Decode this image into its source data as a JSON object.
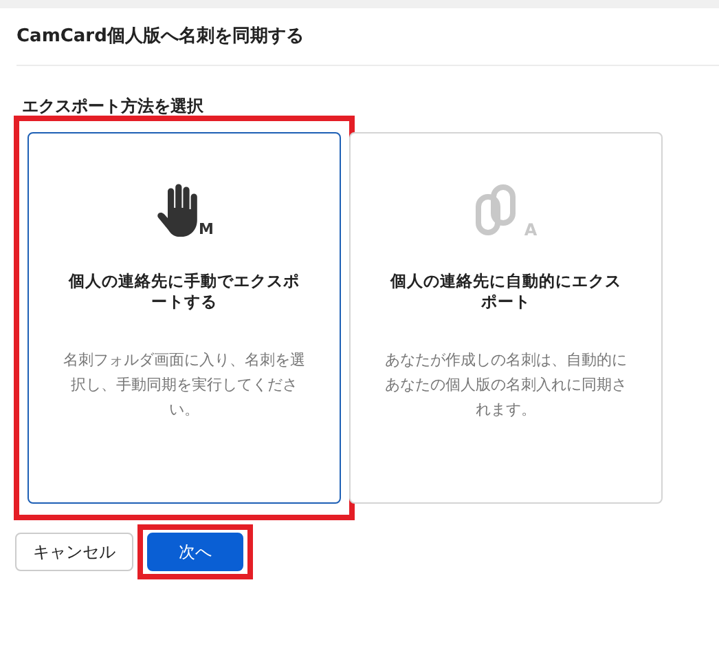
{
  "dialog": {
    "title": "CamCard個人版へ名刺を同期する"
  },
  "section": {
    "heading": "エクスポート方法を選択"
  },
  "options": [
    {
      "kind": "manual",
      "badge": "M",
      "title": "個人の連絡先に手動でエクスポートする",
      "description": "名刺フォルダ画面に入り、名刺を選択し、手動同期を実行してください。",
      "selected": true,
      "highlighted": true
    },
    {
      "kind": "auto",
      "badge": "A",
      "title": "個人の連絡先に自動的にエクスポート",
      "description": "あなたが作成しの名刺は、自動的にあなたの個人版の名刺入れに同期されます。",
      "selected": false,
      "highlighted": false
    }
  ],
  "buttons": [
    {
      "kind": "secondary",
      "label": "キャンセル",
      "highlighted": false
    },
    {
      "kind": "primary",
      "label": "次へ",
      "highlighted": true
    }
  ]
}
